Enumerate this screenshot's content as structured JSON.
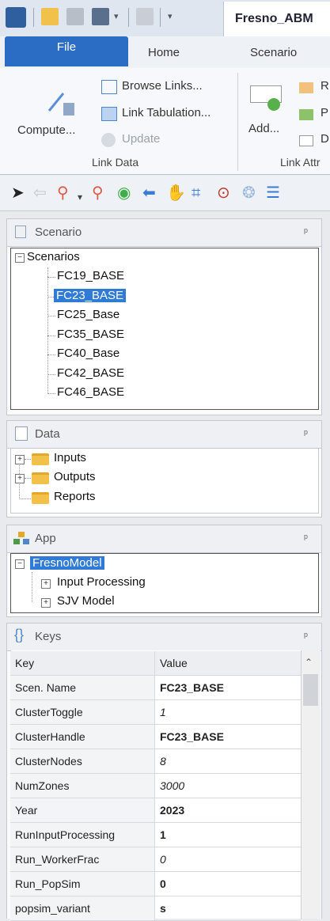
{
  "window": {
    "title_tab": "Fresno_ABM"
  },
  "ribbon_tabs": [
    "File",
    "Home",
    "Scenario"
  ],
  "ribbon": {
    "compute_label": "Compute...",
    "browse_links_label": "Browse Links...",
    "link_tabulation_label": "Link Tabulation...",
    "update_label": "Update",
    "link_data_group": "Link Data",
    "add_label": "Add...",
    "r_label": "R",
    "p_label": "P",
    "d_label": "D",
    "link_attr_group": "Link Attr"
  },
  "scenario_panel": {
    "title": "Scenario",
    "root": "Scenarios",
    "items": [
      "FC19_BASE",
      "FC23_BASE",
      "FC25_Base",
      "FC35_BASE",
      "FC40_Base",
      "FC42_BASE",
      "FC46_BASE"
    ],
    "selected": "FC23_BASE"
  },
  "data_panel": {
    "title": "Data",
    "items": [
      "Inputs",
      "Outputs",
      "Reports"
    ]
  },
  "app_panel": {
    "title": "App",
    "root": "FresnoModel",
    "children": [
      "Input Processing",
      "SJV Model"
    ]
  },
  "keys_panel": {
    "title": "Keys",
    "header_key": "Key",
    "header_value": "Value",
    "rows": [
      {
        "key": "Scen. Name",
        "value": "FC23_BASE",
        "style": "bold"
      },
      {
        "key": "ClusterToggle",
        "value": "1",
        "style": "italic"
      },
      {
        "key": "ClusterHandle",
        "value": "FC23_BASE",
        "style": "bold"
      },
      {
        "key": "ClusterNodes",
        "value": "8",
        "style": "italic"
      },
      {
        "key": "NumZones",
        "value": "3000",
        "style": "italic"
      },
      {
        "key": "Year",
        "value": "2023",
        "style": "bold"
      },
      {
        "key": "RunInputProcessing",
        "value": "1",
        "style": "bold"
      },
      {
        "key": "Run_WorkerFrac",
        "value": "0",
        "style": "italic"
      },
      {
        "key": "Run_PopSim",
        "value": "0",
        "style": "bold"
      },
      {
        "key": "popsim_variant",
        "value": "s",
        "style": "bold"
      }
    ]
  },
  "pin_glyph": "ᵖ",
  "colors": {
    "accent": "#2b6cc4",
    "selection": "#2f7bd6"
  }
}
